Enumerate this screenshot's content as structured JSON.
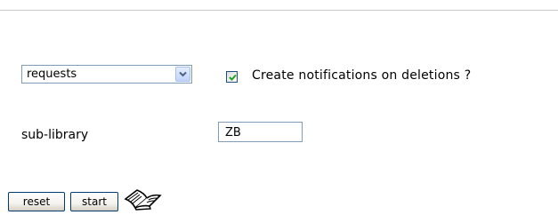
{
  "form": {
    "request_type": {
      "selected": "requests",
      "options": [
        "requests"
      ]
    },
    "notify_checkbox": {
      "checked": true,
      "label": "Create notifications on deletions ?"
    },
    "sub_library": {
      "label": "sub-library",
      "value": "ZB"
    }
  },
  "buttons": {
    "reset_label": "reset",
    "start_label": "start"
  },
  "icons": {
    "select_arrow": "chevron-down-icon",
    "checkmark": "checkmark-icon",
    "help": "open-book-icon"
  },
  "colors": {
    "input_border": "#7f9db9",
    "checkmark": "#21a121",
    "button_border": "#003c74"
  }
}
